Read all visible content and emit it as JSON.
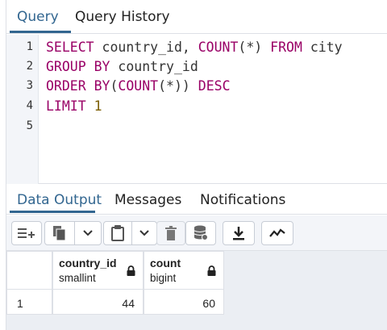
{
  "tabs": [
    "Query",
    "Query History"
  ],
  "editor": {
    "line_numbers": [
      "1",
      "2",
      "3",
      "4",
      "5"
    ],
    "line1": {
      "k1": "SELECT",
      "t1": " country_id, ",
      "k2": "COUNT",
      "t2": "(*) ",
      "k3": "FROM",
      "t3": " city"
    },
    "line2": {
      "k1": "GROUP BY",
      "t1": " country_id"
    },
    "line3": {
      "k1": "ORDER BY",
      "t1": "(",
      "k2": "COUNT",
      "t2": "(*)) ",
      "k3": "DESC"
    },
    "line4": {
      "k1": "LIMIT",
      "n1": "1"
    }
  },
  "output_tabs": [
    "Data Output",
    "Messages",
    "Notifications"
  ],
  "toolbar": {
    "icons": [
      "add-row-icon",
      "copy-icon",
      "chevron-down-icon",
      "paste-icon",
      "chevron-down-icon",
      "delete-icon",
      "save-data-icon",
      "download-icon",
      "graph-icon"
    ]
  },
  "grid": {
    "columns": [
      {
        "name": "country_id",
        "type": "smallint"
      },
      {
        "name": "count",
        "type": "bigint"
      }
    ],
    "rows": [
      {
        "row_number": "1",
        "values": [
          "44",
          "60"
        ]
      }
    ]
  },
  "colors": {
    "accent": "#326690",
    "keyword": "#990066",
    "toolbar_bg": "#f3f5f9",
    "border": "#dde0e6"
  }
}
